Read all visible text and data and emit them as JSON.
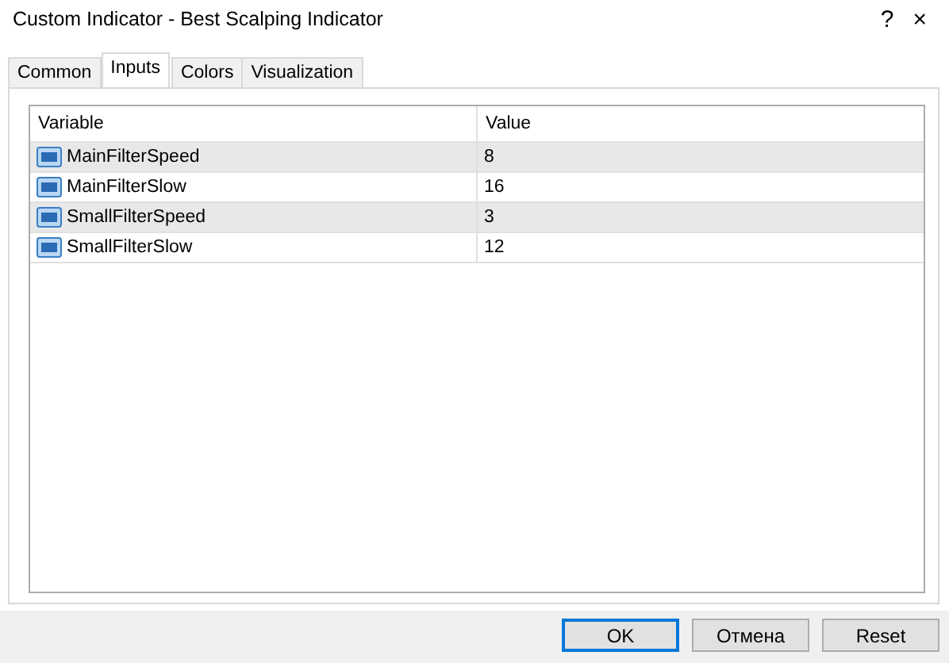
{
  "window": {
    "title": "Custom Indicator - Best Scalping Indicator",
    "help": "?",
    "close": "×"
  },
  "tabs": [
    {
      "label": "Common",
      "selected": false
    },
    {
      "label": "Inputs",
      "selected": true
    },
    {
      "label": "Colors",
      "selected": false
    },
    {
      "label": "Visualization",
      "selected": false
    }
  ],
  "table": {
    "columns": [
      "Variable",
      "Value"
    ],
    "rows": [
      {
        "variable": "MainFilterSpeed",
        "value": "8"
      },
      {
        "variable": "MainFilterSlow",
        "value": "16"
      },
      {
        "variable": "SmallFilterSpeed",
        "value": "3"
      },
      {
        "variable": "SmallFilterSlow",
        "value": "12"
      }
    ]
  },
  "buttons": [
    {
      "label": "OK",
      "default": true
    },
    {
      "label": "Отмена",
      "default": false
    },
    {
      "label": "Reset",
      "default": false
    }
  ]
}
